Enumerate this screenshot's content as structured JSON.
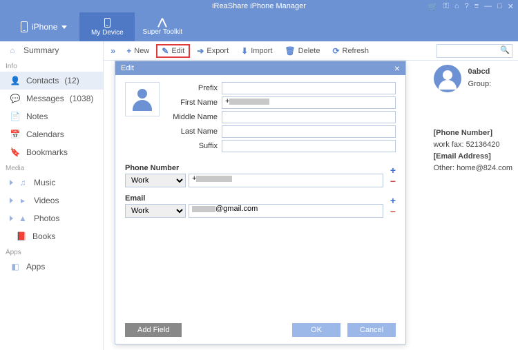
{
  "titlebar": {
    "title": "iReaShare iPhone Manager"
  },
  "header": {
    "device": "iPhone",
    "tab_device": "My Device",
    "tab_toolkit": "Super Toolkit"
  },
  "sidebar": {
    "summary": "Summary",
    "group_info": "Info",
    "contacts": "Contacts",
    "contacts_count": "(12)",
    "messages": "Messages",
    "messages_count": "(1038)",
    "notes": "Notes",
    "calendars": "Calendars",
    "bookmarks": "Bookmarks",
    "group_media": "Media",
    "music": "Music",
    "videos": "Videos",
    "photos": "Photos",
    "books": "Books",
    "group_apps": "Apps",
    "apps": "Apps"
  },
  "toolbar": {
    "new": "New",
    "edit": "Edit",
    "export": "Export",
    "import": "Import",
    "delete": "Delete",
    "refresh": "Refresh"
  },
  "details": {
    "name": "0abcd",
    "group_label": "Group:",
    "phone_header": "[Phone Number]",
    "phone_line": "work fax:  52136420",
    "email_header": "[Email Address]",
    "email_line": "Other:  home@824.com"
  },
  "dialog": {
    "title": "Edit",
    "prefix": "Prefix",
    "first_name": "First Name",
    "middle_name": "Middle Name",
    "last_name": "Last Name",
    "suffix": "Suffix",
    "phone_section": "Phone Number",
    "email_section": "Email",
    "type_work": "Work",
    "first_name_val": "+",
    "phone_val": "+",
    "email_val_suffix": "@gmail.com",
    "add_field": "Add Field",
    "ok": "OK",
    "cancel": "Cancel"
  }
}
